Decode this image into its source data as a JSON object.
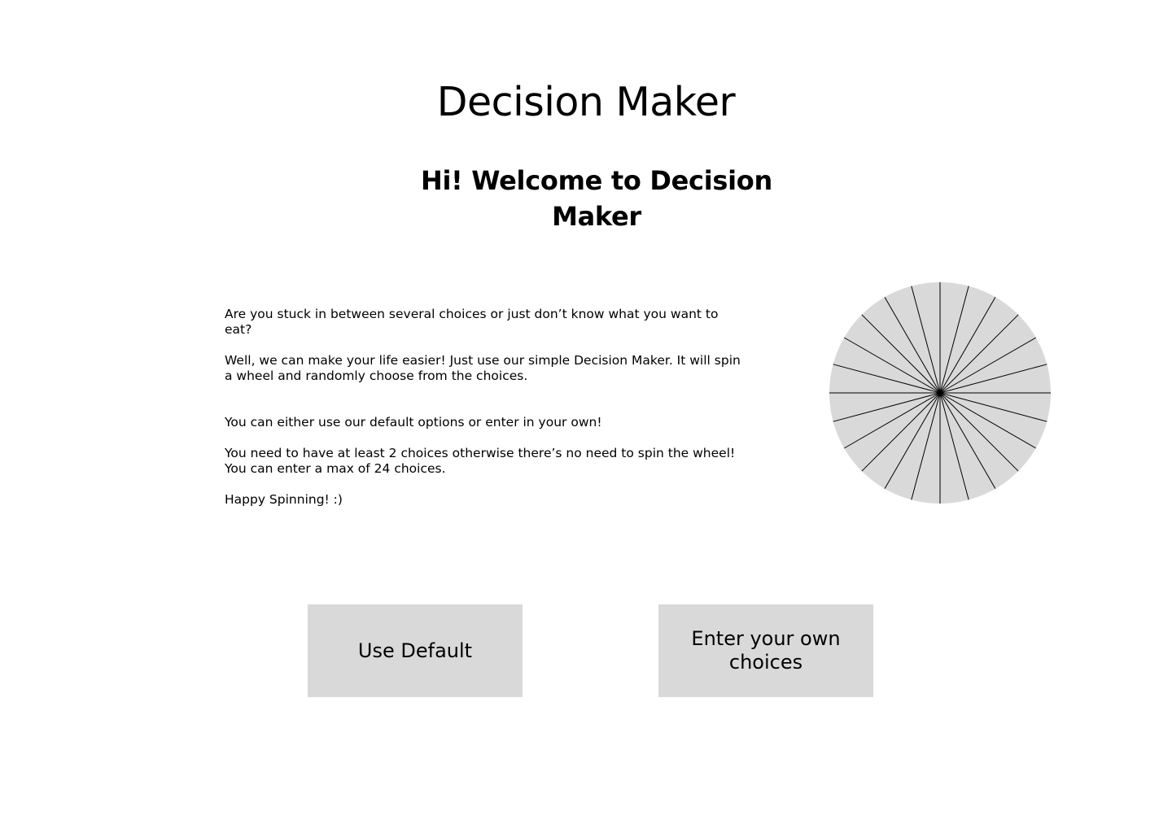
{
  "header": {
    "title": "Decision Maker",
    "welcome": "Hi! Welcome to Decision Maker"
  },
  "intro": {
    "paragraphs": [
      "Are you stuck in between several choices or just don’t know what you want to eat?",
      "Well, we can make your life easier! Just use our simple Decision Maker. It will spin\na wheel and randomly choose from the choices.",
      "You can either use our default options or enter in your own!",
      "You need to have at least 2 choices otherwise there’s no need to spin the wheel!\nYou can enter a max of 24 choices.",
      "Happy Spinning! :)"
    ]
  },
  "wheel": {
    "segments": 24,
    "fill_color": "#d9d9d9",
    "line_color": "#000000"
  },
  "actions": {
    "use_default_label": "Use Default",
    "enter_own_label": "Enter your own choices"
  },
  "colors": {
    "button_bg": "#d9d9d9",
    "background": "#ffffff",
    "text": "#000000"
  }
}
